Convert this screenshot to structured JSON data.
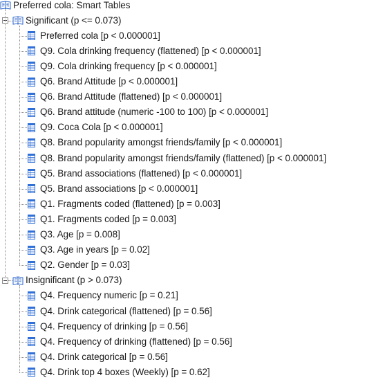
{
  "root": {
    "label": "Preferred cola: Smart Tables",
    "icon": "book-icon"
  },
  "groups": [
    {
      "label": "Significant (p <= 0.073)",
      "icon": "book-icon",
      "expanded": true,
      "items": [
        "Preferred cola [p < 0.000001]",
        "Q9. Cola drinking frequency (flattened) [p < 0.000001]",
        "Q9. Cola drinking frequency [p < 0.000001]",
        "Q6. Brand Attitude [p < 0.000001]",
        "Q6. Brand Attitude (flattened) [p < 0.000001]",
        "Q6. Brand attitude (numeric -100 to 100) [p < 0.000001]",
        "Q9. Coca Cola [p < 0.000001]",
        "Q8. Brand popularity amongst friends/family [p < 0.000001]",
        "Q8. Brand popularity amongst friends/family (flattened) [p < 0.000001]",
        "Q5.  Brand associations (flattened) [p < 0.000001]",
        "Q5.  Brand associations [p < 0.000001]",
        "Q1.  Fragments coded (flattened) [p = 0.003]",
        "Q1.  Fragments coded [p = 0.003]",
        "Q3. Age [p = 0.008]",
        "Q3. Age in years [p = 0.02]",
        "Q2. Gender [p = 0.03]"
      ]
    },
    {
      "label": "Insignificant (p > 0.073)",
      "icon": "book-icon",
      "expanded": true,
      "items": [
        "Q4.  Frequency numeric [p = 0.21]",
        "Q4. Drink categorical (flattened) [p = 0.56]",
        "Q4. Frequency of drinking [p = 0.56]",
        "Q4. Frequency of drinking (flattened) [p = 0.56]",
        "Q4. Drink categorical [p = 0.56]",
        "Q4.  Drink top 4 boxes (Weekly) [p = 0.62]"
      ]
    }
  ],
  "colors": {
    "text": "#1a1a1a",
    "tree_line": "#8a8a8a",
    "book_blue": "#2a63c9",
    "table_blue": "#2f6fd8"
  }
}
